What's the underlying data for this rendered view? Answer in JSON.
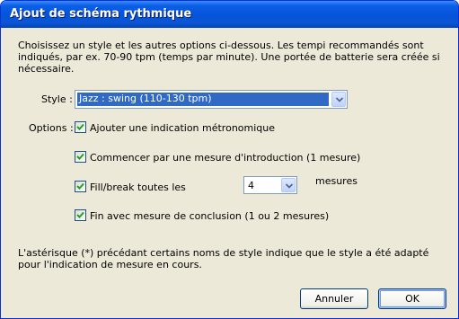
{
  "window": {
    "title": "Ajout de schéma rythmique"
  },
  "intro_text": "Choisissez un style et les autres options ci-dessous. Les tempi recommandés sont indiqués, par ex. 70-90 tpm (temps par minute). Une portée de batterie sera créée si nécessaire.",
  "style": {
    "label": "Style :",
    "selected": "Jazz : swing (110-130 tpm)"
  },
  "options": {
    "label": "Options :",
    "metronome": {
      "label": "Ajouter une indication métronomique",
      "checked": true
    },
    "intro_measure": {
      "label": "Commencer par une mesure d'introduction (1 mesure)",
      "checked": true
    },
    "fill_break": {
      "label": "Fill/break toutes les",
      "checked": true,
      "value": "4",
      "unit": "mesures"
    },
    "conclusion": {
      "label": "Fin avec mesure de conclusion (1 ou 2 mesures)",
      "checked": true
    }
  },
  "footnote": "L'astérisque (*) précédant certains noms de style indique que le style a été adapté pour l'indication de mesure en cours.",
  "buttons": {
    "cancel": "Annuler",
    "ok": "OK"
  }
}
